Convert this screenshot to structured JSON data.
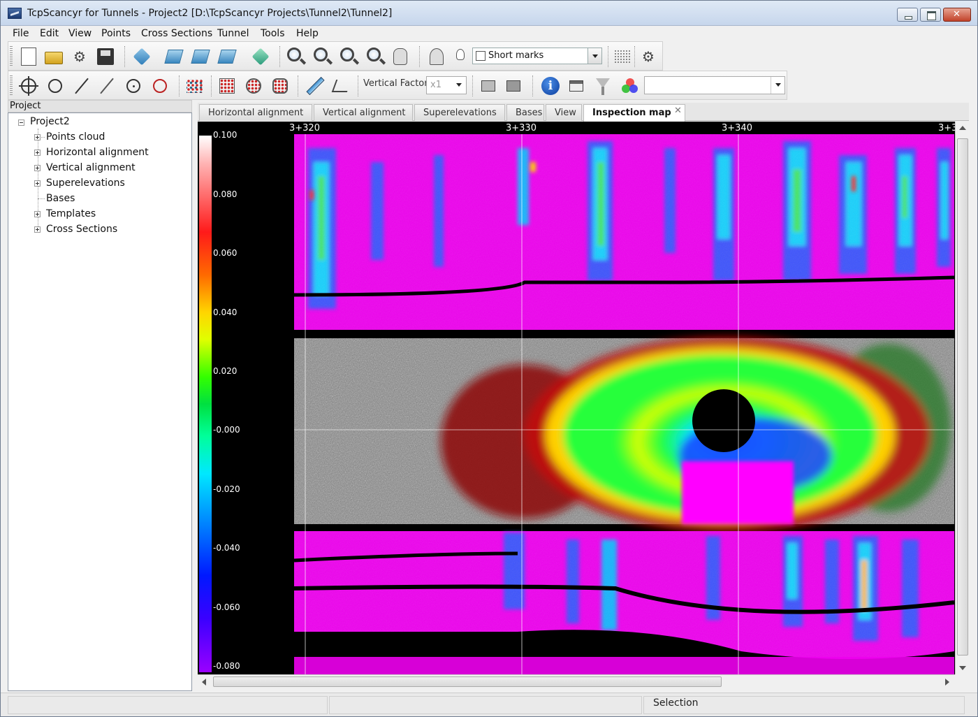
{
  "window": {
    "title": "TcpScancyr for Tunnels - Project2 [D:\\TcpScancyr Projects\\Tunnel2\\Tunnel2]"
  },
  "menu": [
    "File",
    "Edit",
    "View",
    "Points",
    "Cross Sections",
    "Tunnel",
    "Tools",
    "Help"
  ],
  "toolbar": {
    "short_marks_label": "Short marks",
    "vertical_factor_label": "Vertical Factor",
    "vertical_factor_value": "x1",
    "combo_value": ""
  },
  "icons": {
    "toolbar1": [
      "new-document-icon",
      "open-folder-icon",
      "settings-icon",
      "save-icon",
      "cube-view-icon",
      "front-view-icon",
      "side-view-icon",
      "top-view-icon",
      "rotate-view-icon",
      "zoom-in-icon",
      "zoom-out-icon",
      "zoom-window-icon",
      "zoom-extents-icon",
      "pan-hand-icon",
      "lamp-icon",
      "bulb-icon",
      "grid-icon",
      "gear-icon"
    ],
    "toolbar2": [
      "crosshair-icon",
      "circle-icon",
      "line-icon",
      "line-alt-icon",
      "center-circle-icon",
      "circle-red-icon",
      "point-cloud-icon",
      "points-box-icon",
      "points-circle-icon",
      "points-polygon-icon",
      "ruler-icon",
      "angle-icon",
      "camera-icon",
      "camera-multi-icon",
      "info-icon",
      "window-icon",
      "filter-icon",
      "colors-icon"
    ]
  },
  "project_panel": {
    "header": "Project",
    "root": "Project2",
    "items": [
      {
        "label": "Points cloud",
        "expandable": true
      },
      {
        "label": "Horizontal alignment",
        "expandable": true
      },
      {
        "label": "Vertical alignment",
        "expandable": true
      },
      {
        "label": "Superelevations",
        "expandable": true
      },
      {
        "label": "Bases",
        "expandable": false
      },
      {
        "label": "Templates",
        "expandable": true
      },
      {
        "label": "Cross Sections",
        "expandable": true
      }
    ]
  },
  "tabs": [
    {
      "label": "Horizontal alignment",
      "active": false
    },
    {
      "label": "Vertical alignment",
      "active": false
    },
    {
      "label": "Superelevations",
      "active": false
    },
    {
      "label": "Bases",
      "active": false
    },
    {
      "label": "View",
      "active": false
    },
    {
      "label": "Inspection map",
      "active": true
    }
  ],
  "inspection_map": {
    "scale_labels": [
      "0.100",
      "0.080",
      "0.060",
      "0.040",
      "0.020",
      "-0.000",
      "-0.020",
      "-0.040",
      "-0.060",
      "-0.080"
    ],
    "stations": [
      "3+320",
      "3+330",
      "3+340",
      "3+3"
    ]
  },
  "status": {
    "text": "Selection"
  },
  "colors": {
    "magenta": "#ff00ff",
    "point_gray": "#cfcfcf",
    "background": "#000000"
  }
}
